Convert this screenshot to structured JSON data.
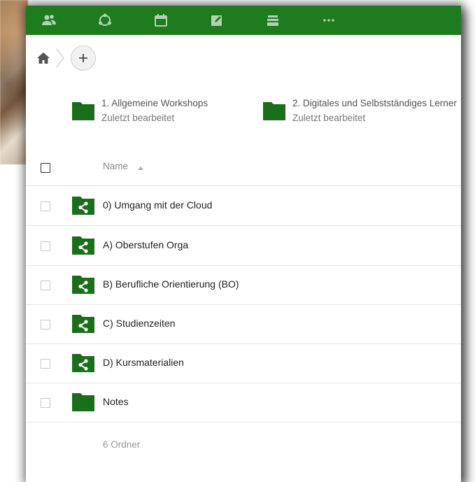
{
  "colors": {
    "topbar": "#1e7b1e",
    "folder": "#1a6b1a",
    "folder_dark": "#155915"
  },
  "header": {
    "apps": [
      {
        "icon": "contacts-icon"
      },
      {
        "icon": "circles-icon"
      },
      {
        "icon": "calendar-icon"
      },
      {
        "icon": "notes-edit-icon"
      },
      {
        "icon": "deck-icon"
      },
      {
        "icon": "more-apps-icon"
      }
    ]
  },
  "breadcrumb": {
    "home_icon": "home-icon",
    "add_label": "+"
  },
  "recent": [
    {
      "number": "1.",
      "title": "Allgemeine Workshops",
      "subtitle": "Zuletzt bearbeitet"
    },
    {
      "number": "2.",
      "title": "Digitales und Selbstständiges Lerner",
      "subtitle": "Zuletzt bearbeitet"
    }
  ],
  "list": {
    "column_name": "Name",
    "sort_icon": "sort-ascending-icon",
    "rows": [
      {
        "name": "0) Umgang mit der Cloud",
        "shared": true
      },
      {
        "name": "A) Oberstufen Orga",
        "shared": true
      },
      {
        "name": "B) Berufliche Orientierung (BO)",
        "shared": true
      },
      {
        "name": "C) Studienzeiten",
        "shared": true
      },
      {
        "name": "D) Kursmaterialien",
        "shared": true
      },
      {
        "name": "Notes",
        "shared": false
      }
    ],
    "summary": "6 Ordner"
  }
}
